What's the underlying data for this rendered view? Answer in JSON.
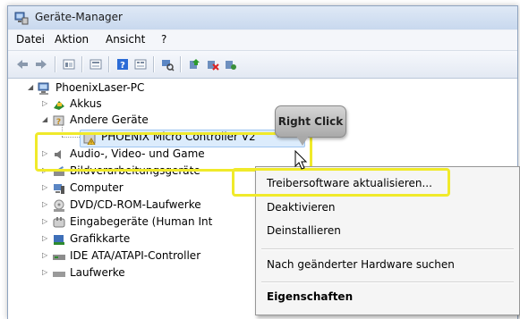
{
  "window": {
    "title": "Geräte-Manager"
  },
  "menubar": {
    "items": [
      "Datei",
      "Aktion",
      "Ansicht",
      "?"
    ]
  },
  "toolbar": {
    "buttons": [
      "back-icon",
      "forward-icon",
      "properties-view-icon",
      "view-icon",
      "help-icon",
      "resources-icon",
      "scan-hardware-icon",
      "update-driver-icon",
      "uninstall-icon",
      "disable-icon"
    ]
  },
  "tree": {
    "root": "PhoenixLaser-PC",
    "nodes": [
      {
        "label": "Akkus"
      },
      {
        "label": "Andere Geräte"
      },
      {
        "label": "PHOENIX Micro Controller V2"
      },
      {
        "label": "Audio-, Video- und Game"
      },
      {
        "label": "Bildverarbeitungsgeräte"
      },
      {
        "label": "Computer"
      },
      {
        "label": "DVD/CD-ROM-Laufwerke"
      },
      {
        "label": "Eingabegeräte (Human Int"
      },
      {
        "label": "Grafikkarte"
      },
      {
        "label": "IDE ATA/ATAPI-Controller"
      },
      {
        "label": "Laufwerke"
      }
    ]
  },
  "callout": {
    "text": "Right Click"
  },
  "context_menu": {
    "items": [
      {
        "label": "Treibersoftware aktualisieren..."
      },
      {
        "label": "Deaktivieren"
      },
      {
        "label": "Deinstallieren"
      },
      {
        "label": "Nach geänderter Hardware suchen"
      },
      {
        "label": "Eigenschaften"
      }
    ]
  },
  "colors": {
    "highlight": "#f0ea2a",
    "titlebar": "#c8d8ee",
    "menu_bg": "#f5f5f5"
  }
}
